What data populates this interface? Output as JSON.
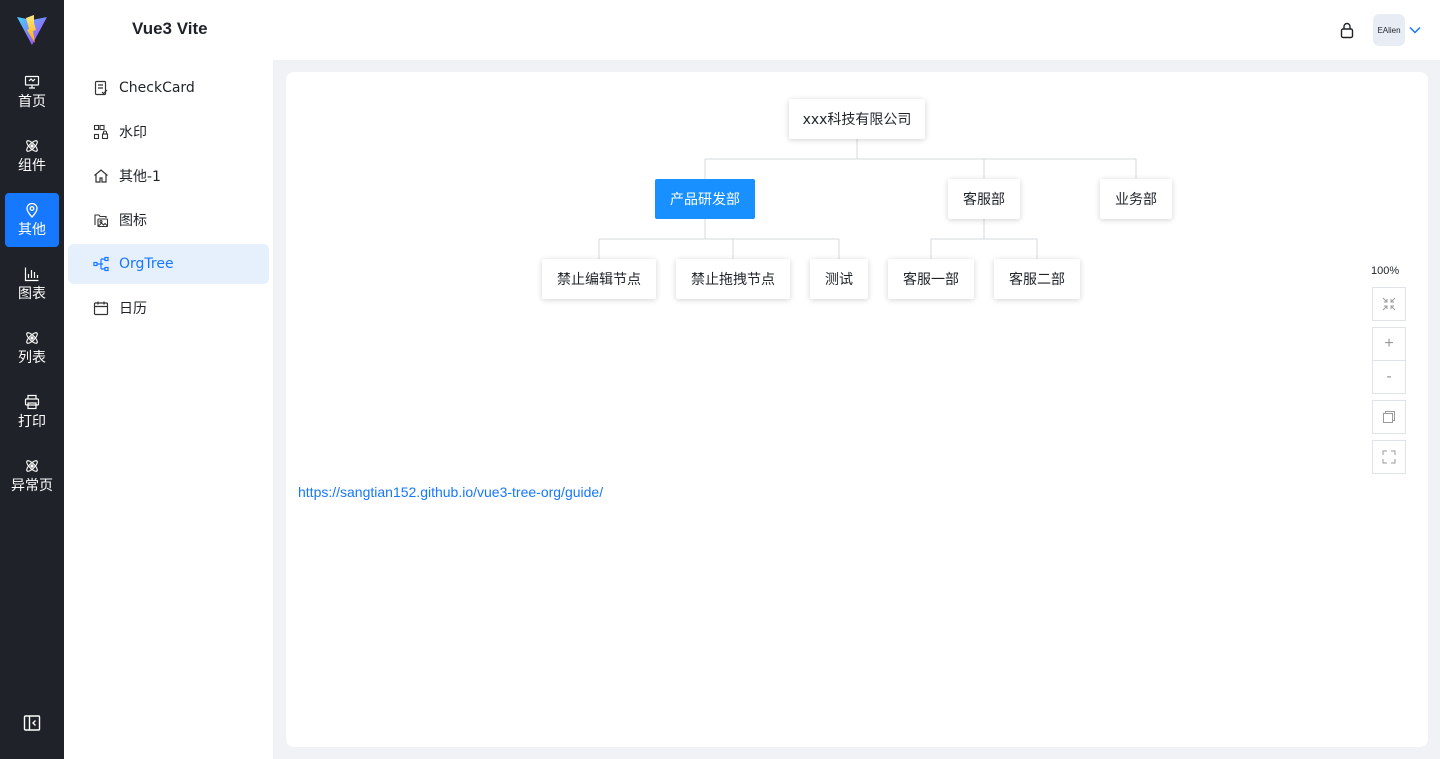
{
  "header": {
    "title": "Vue3 Vite",
    "user": "EAlien"
  },
  "rail": {
    "items": [
      {
        "label": "首页",
        "icon": "monitor-icon"
      },
      {
        "label": "组件",
        "icon": "atom-icon"
      },
      {
        "label": "其他",
        "icon": "location-pin-icon"
      },
      {
        "label": "图表",
        "icon": "bar-chart-icon"
      },
      {
        "label": "列表",
        "icon": "atom-icon"
      },
      {
        "label": "打印",
        "icon": "printer-icon"
      },
      {
        "label": "异常页",
        "icon": "atom-icon"
      }
    ],
    "active_index": 2
  },
  "submenu": {
    "items": [
      {
        "label": "CheckCard",
        "icon": "check-list-icon"
      },
      {
        "label": "水印",
        "icon": "qrcode-lock-icon"
      },
      {
        "label": "其他-1",
        "icon": "home-icon"
      },
      {
        "label": "图标",
        "icon": "image-files-icon"
      },
      {
        "label": "OrgTree",
        "icon": "org-tree-icon"
      },
      {
        "label": "日历",
        "icon": "calendar-icon"
      }
    ],
    "active_index": 4
  },
  "org_tree": {
    "root": "xxx科技有限公司",
    "level1": [
      "产品研发部",
      "客服部",
      "业务部"
    ],
    "rd_children": [
      "禁止编辑节点",
      "禁止拖拽节点",
      "测试"
    ],
    "cs_children": [
      "客服一部",
      "客服二部"
    ],
    "highlight_color": "#1890ff"
  },
  "toolbar": {
    "zoom_label": "100%",
    "zoom_in": "+",
    "zoom_out": "-"
  },
  "link": {
    "text": "https://sangtian152.github.io/vue3-tree-org/guide/"
  },
  "colors": {
    "rail_bg": "#1f2329",
    "accent": "#1677ff",
    "active_sub_bg": "#e6f0fd"
  }
}
